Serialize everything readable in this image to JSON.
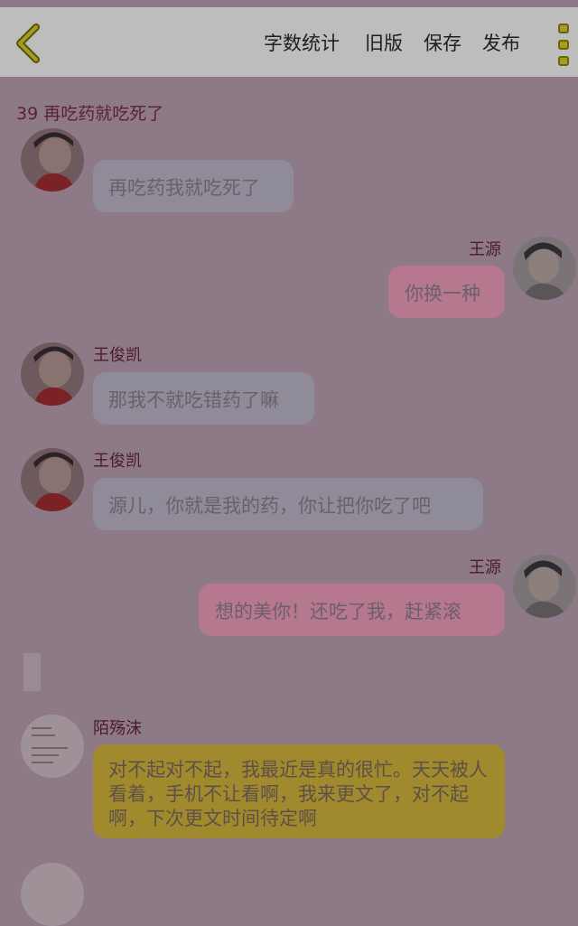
{
  "toolbar": {
    "back_icon": "chevron-left-icon",
    "word_count": "字数统计",
    "old_version": "旧版",
    "save": "保存",
    "publish": "发布",
    "more_icon": "more-vertical-icon"
  },
  "chapter": {
    "title": "39 再吃药就吃死了"
  },
  "messages": [
    {
      "side": "left",
      "sender": "",
      "text": "再吃药我就吃死了"
    },
    {
      "side": "right",
      "sender": "王源",
      "text": "你换一种"
    },
    {
      "side": "left",
      "sender": "王俊凯",
      "text": "那我不就吃错药了嘛"
    },
    {
      "side": "left",
      "sender": "王俊凯",
      "text": "源儿，你就是我的药，你让把你吃了吧"
    },
    {
      "side": "right",
      "sender": "王源",
      "text": "想的美你！还吃了我，赶紧滚"
    },
    {
      "side": "left",
      "sender": "陌殇沫",
      "text": "对不起对不起，我最近是真的很忙。天天被人看着，手机不让看啊，我来更文了，对不起啊，下次更文时间待定啊"
    }
  ],
  "colors": {
    "overlay": "#8e7a86",
    "header": "#bdbdbd",
    "left_bubble": "#8f8b99",
    "right_bubble": "#b5788f",
    "author_bubble": "#a1892e",
    "accent": "#a49c2a"
  }
}
